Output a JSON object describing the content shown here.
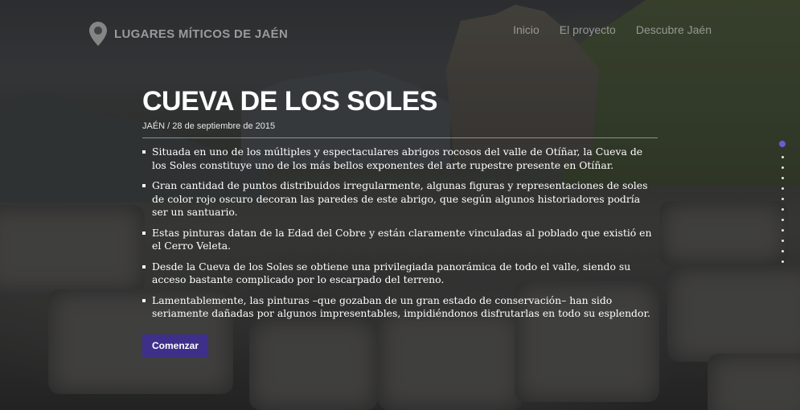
{
  "site": {
    "name": "LUGARES MÍTICOS DE JAÉN",
    "logo_icon": "map-pin-icon"
  },
  "nav": {
    "items": [
      {
        "label": "Inicio"
      },
      {
        "label": "El proyecto"
      },
      {
        "label": "Descubre Jaén"
      }
    ]
  },
  "article": {
    "title": "CUEVA DE LOS SOLES",
    "meta": "JAÉN / 28 de septiembre de 2015",
    "bullets": [
      "Situada en uno de los múltiples y espectaculares abrigos rocosos del valle de Otíñar, la Cueva de los Soles constituye uno de los más bellos exponentes del arte rupestre presente en Otíñar.",
      "Gran cantidad de puntos distribuidos irregularmente, algunas figuras y representaciones de soles de color rojo oscuro decoran las paredes de este abrigo, que según algunos historiadores podría ser un santuario.",
      "Estas pinturas datan de la Edad del Cobre y están claramente vinculadas al poblado que existió en el Cerro Veleta.",
      "Desde la Cueva de los Soles se obtiene una privilegiada panorámica de todo el valle, siendo su acceso bastante complicado por lo escarpado del terreno.",
      "Lamentablemente, las pinturas –que gozaban de un gran estado de conservación– han sido seriamente dañadas por algunos impresentables, impidiéndonos disfrutarlas en todo su esplendor."
    ],
    "button_label": "Comenzar"
  },
  "slider": {
    "total": 12,
    "active_index": 0
  },
  "colors": {
    "accent": "#3e2f8a",
    "active_dot": "#6c5bd4"
  }
}
